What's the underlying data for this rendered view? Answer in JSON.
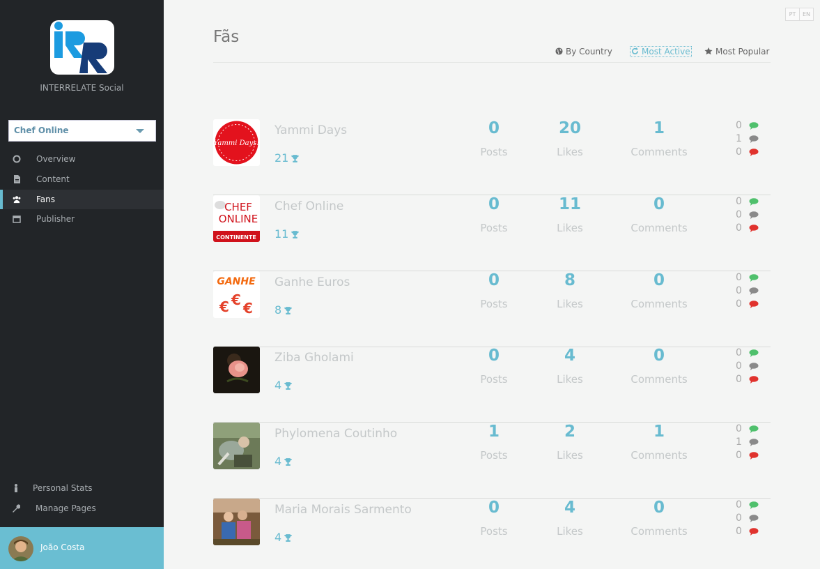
{
  "sidebar": {
    "logo_text": "iRR",
    "brand": "INTERRELATE Social",
    "page_select": "Chef Online",
    "nav": [
      {
        "label": "Overview",
        "icon": "circle-icon"
      },
      {
        "label": "Content",
        "icon": "document-icon"
      },
      {
        "label": "Fans",
        "icon": "users-icon",
        "active": true
      },
      {
        "label": "Publisher",
        "icon": "calendar-icon"
      }
    ],
    "bottom": [
      {
        "label": "Personal Stats",
        "icon": "person-icon"
      },
      {
        "label": "Manage Pages",
        "icon": "wrench-icon"
      }
    ],
    "user": "João Costa"
  },
  "lang": {
    "pt": "PT",
    "en": "EN"
  },
  "main": {
    "title": "Fãs",
    "filters": {
      "by_country": "By Country",
      "most_active": "Most Active",
      "most_popular": "Most Popular"
    },
    "stat_labels": {
      "posts": "Posts",
      "likes": "Likes",
      "comments": "Comments"
    },
    "fans": [
      {
        "name": "Yammi Days",
        "score": "21",
        "posts": "0",
        "likes": "20",
        "comments": "1",
        "pos": "0",
        "neu": "1",
        "neg": "0"
      },
      {
        "name": "Chef Online",
        "score": "11",
        "posts": "0",
        "likes": "11",
        "comments": "0",
        "pos": "0",
        "neu": "0",
        "neg": "0"
      },
      {
        "name": "Ganhe Euros",
        "score": "8",
        "posts": "0",
        "likes": "8",
        "comments": "0",
        "pos": "0",
        "neu": "0",
        "neg": "0"
      },
      {
        "name": "Ziba Gholami",
        "score": "4",
        "posts": "0",
        "likes": "4",
        "comments": "0",
        "pos": "0",
        "neu": "0",
        "neg": "0"
      },
      {
        "name": "Phylomena Coutinho",
        "score": "4",
        "posts": "1",
        "likes": "2",
        "comments": "1",
        "pos": "0",
        "neu": "1",
        "neg": "0"
      },
      {
        "name": "Maria Morais Sarmento",
        "score": "4",
        "posts": "0",
        "likes": "4",
        "comments": "0",
        "pos": "0",
        "neu": "0",
        "neg": "0"
      }
    ],
    "thumb_texts": {
      "yammi": "Yammi Days!",
      "chef_top": "CHEF",
      "chef_mid": "ONLINE",
      "chef_bottom": "CONTINENTE",
      "ganhe": "GANHE"
    }
  },
  "colors": {
    "accent": "#68bbd0",
    "sidebar_bg": "#222528",
    "positive": "#4fc06c",
    "neutral": "#8a8a8a",
    "negative": "#e0322d"
  }
}
